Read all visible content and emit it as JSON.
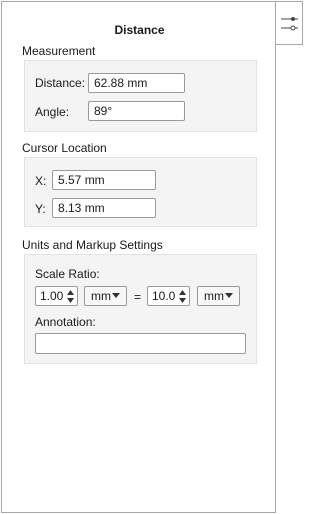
{
  "panel": {
    "title": "Distance"
  },
  "side_tab": {
    "icon": "sliders-icon"
  },
  "measurement": {
    "section_label": "Measurement",
    "distance_label": "Distance:",
    "distance_value": "62.88 mm",
    "angle_label": "Angle:",
    "angle_value": "89°"
  },
  "cursor": {
    "section_label": "Cursor Location",
    "x_label": "X:",
    "x_value": "5.57 mm",
    "y_label": "Y:",
    "y_value": "8.13 mm"
  },
  "units": {
    "section_label": "Units and Markup Settings",
    "scale_ratio_label": "Scale Ratio:",
    "left_value": "1.00",
    "left_unit": "mm",
    "equals": "=",
    "right_value": "10.0",
    "right_unit": "mm",
    "annotation_label": "Annotation:",
    "annotation_value": ""
  }
}
